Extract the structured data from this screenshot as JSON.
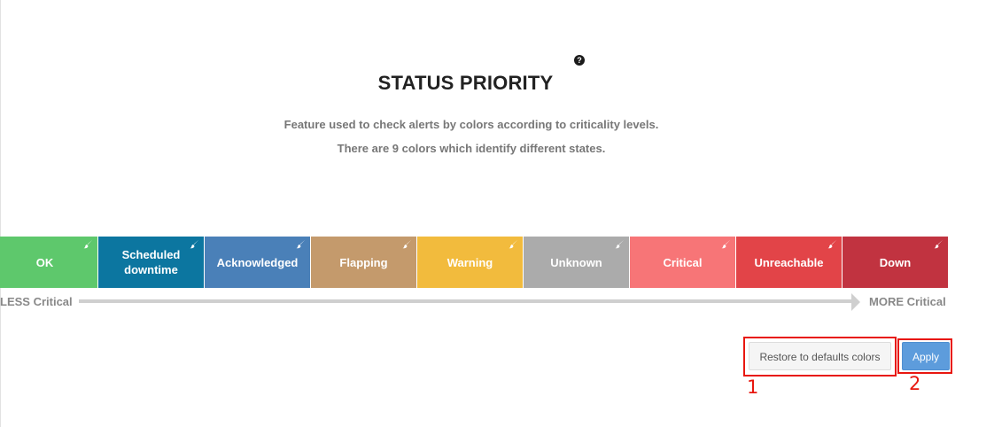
{
  "header": {
    "title": "STATUS PRIORITY",
    "help_icon": "question-circle-icon",
    "help_glyph": "?"
  },
  "description": {
    "line1": "Feature used to check alerts by colors according to criticality levels.",
    "line2": "There are 9 colors which identify different states."
  },
  "statuses": [
    {
      "label": "OK",
      "color": "#5ec86c"
    },
    {
      "label": "Scheduled downtime",
      "color": "#0c76a0"
    },
    {
      "label": "Acknowledged",
      "color": "#4a80b8"
    },
    {
      "label": "Flapping",
      "color": "#c49a6c"
    },
    {
      "label": "Warning",
      "color": "#f2bb3d"
    },
    {
      "label": "Unknown",
      "color": "#ababab"
    },
    {
      "label": "Critical",
      "color": "#f77577"
    },
    {
      "label": "Unreachable",
      "color": "#e24448"
    },
    {
      "label": "Down",
      "color": "#c13340"
    }
  ],
  "status_edit_icon": "brush-icon",
  "scale": {
    "less_label": "LESS Critical",
    "more_label": "MORE Critical"
  },
  "actions": {
    "restore_label": "Restore to defaults colors",
    "apply_label": "Apply"
  },
  "annotations": {
    "marker1": "1",
    "marker2": "2",
    "color": "#e8170f"
  }
}
